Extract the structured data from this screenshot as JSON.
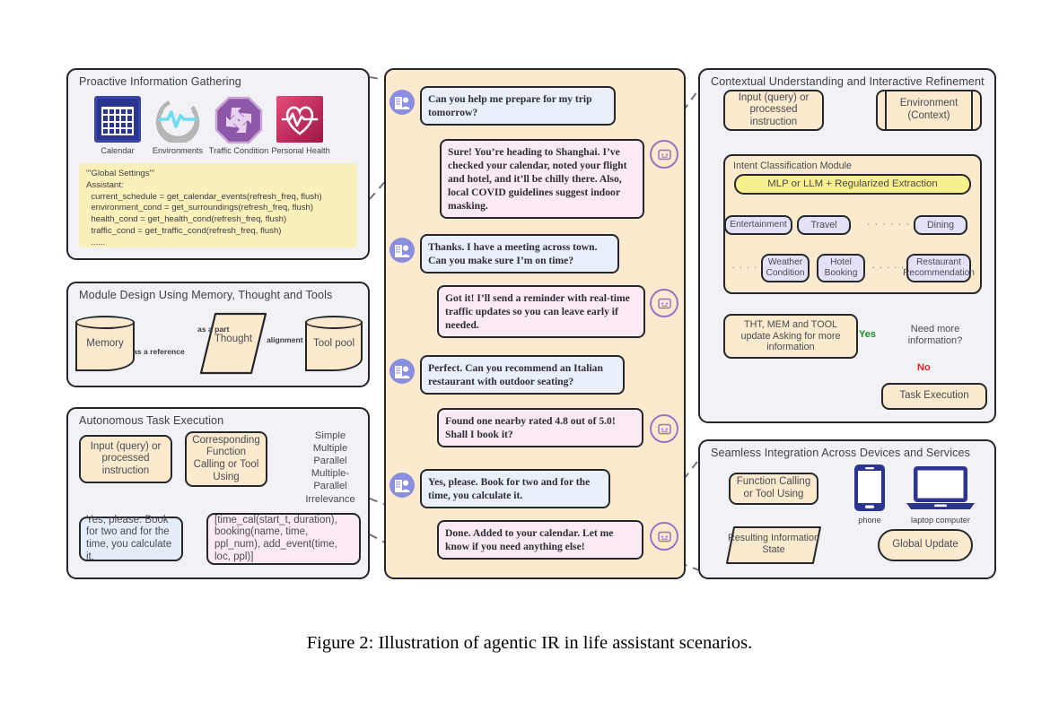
{
  "caption": "Figure 2: Illustration of agentic IR in life assistant scenarios.",
  "panels": {
    "proactive": {
      "title": "Proactive Information Gathering",
      "icons": [
        {
          "name": "calendar-icon",
          "label": "Calendar"
        },
        {
          "name": "environments-icon",
          "label": "Environments"
        },
        {
          "name": "traffic-condition-icon",
          "label": "Traffic Condition"
        },
        {
          "name": "personal-health-icon",
          "label": "Personal Health"
        }
      ],
      "code": "'''Global Settings'''\nAssistant:\n  current_schedule = get_calendar_events(refresh_freq, flush)\n  environment_cond = get_surroundings(refresh_freq, flush)\n  health_cond = get_health_cond(refresh_freq, flush)\n  traffic_cond = get_traffic_cond(refresh_freq, flush)\n  ......"
    },
    "module_design": {
      "title": "Module Design Using Memory, Thought and Tools",
      "memory": "Memory",
      "thought": "Thought",
      "tool_pool": "Tool pool",
      "edge_as_a_part": "as a part",
      "edge_as_a_reference": "as a reference",
      "edge_alignment": "alignment"
    },
    "autonomous": {
      "title": "Autonomous Task Execution",
      "input_node": "Input (query) or processed instruction",
      "function_node": "Corresponding Function Calling or Tool Using",
      "call_types": [
        "Simple",
        "Multiple",
        "Parallel",
        "Multiple-Parallel",
        "Irrelevance"
      ],
      "example_query": "Yes, please. Book for two and for the time, you calculate it.",
      "example_calls": "[time_cal(start_t, duration), booking(name, time, ppl_num), add_event(time, loc, ppl)]"
    },
    "contextual": {
      "title": "Contextual Understanding and Interactive Refinement",
      "input_node": "Input (query) or processed instruction",
      "environment_node": "Environment (Context)",
      "intent_module_title": "Intent Classification Module",
      "extractor": "MLP or LLM + Regularized Extraction",
      "intents": [
        "Entertainment",
        "Travel",
        "Dining"
      ],
      "intents_ellipsis": "· · · · · ·",
      "subtasks_left_ellipsis": "· · · · ·",
      "subtasks_mid_ellipsis": "· · · · ·",
      "subtasks": [
        "Weather Condition",
        "Hotel Booking",
        "Restaurant Recommendation"
      ],
      "update_node": "THT, MEM and TOOL update Asking for more information",
      "decision_node": "Need more information?",
      "yes_label": "Yes",
      "no_label": "No",
      "task_execution": "Task Execution"
    },
    "seamless": {
      "title": "Seamless Integration Across Devices and Services",
      "function_node": "Function Calling or Tool Using",
      "state_node": "Resulting Information State",
      "global_update": "Global Update",
      "devices": [
        {
          "name": "phone-icon",
          "label": "phone"
        },
        {
          "name": "laptop-icon",
          "label": "laptop computer"
        }
      ]
    }
  },
  "chat": {
    "messages": [
      {
        "role": "user",
        "text": "Can you help me prepare for my trip tomorrow?"
      },
      {
        "role": "bot",
        "text": "Sure! You’re heading to Shanghai. I’ve checked your calendar, noted your flight and hotel, and it’ll be chilly there. Also, local COVID guidelines suggest indoor masking."
      },
      {
        "role": "user",
        "text": "Thanks. I have a meeting across town. Can you make sure I’m on time?"
      },
      {
        "role": "bot",
        "text": "Got it! I’ll send a reminder with real-time traffic updates so you can leave early if needed."
      },
      {
        "role": "user",
        "text": "Perfect. Can you recommend an Italian restaurant with outdoor seating?"
      },
      {
        "role": "bot",
        "text": "Found one nearby rated 4.8 out of 5.0! Shall I book it?"
      },
      {
        "role": "user",
        "text": "Yes, please. Book for two and for the time, you calculate it."
      },
      {
        "role": "bot",
        "text": "Done. Added to your calendar. Let me know if you need anything else!"
      }
    ]
  },
  "colors": {
    "panel_bg": "#f1f2f5",
    "chat_bg": "#fbeacd",
    "node_bg": "#fbeacd",
    "intent_bg": "#e3e1f7",
    "extractor_bg": "#f8f08a",
    "user_bubble": "#e9f0fa",
    "bot_bubble": "#fbeaf4",
    "user_avatar": "#8b8ede",
    "bot_avatar_ring": "#9a74c4",
    "yes_arrow": "#1f8a2f",
    "no_arrow": "#e02020",
    "stroke": "#26272c"
  }
}
